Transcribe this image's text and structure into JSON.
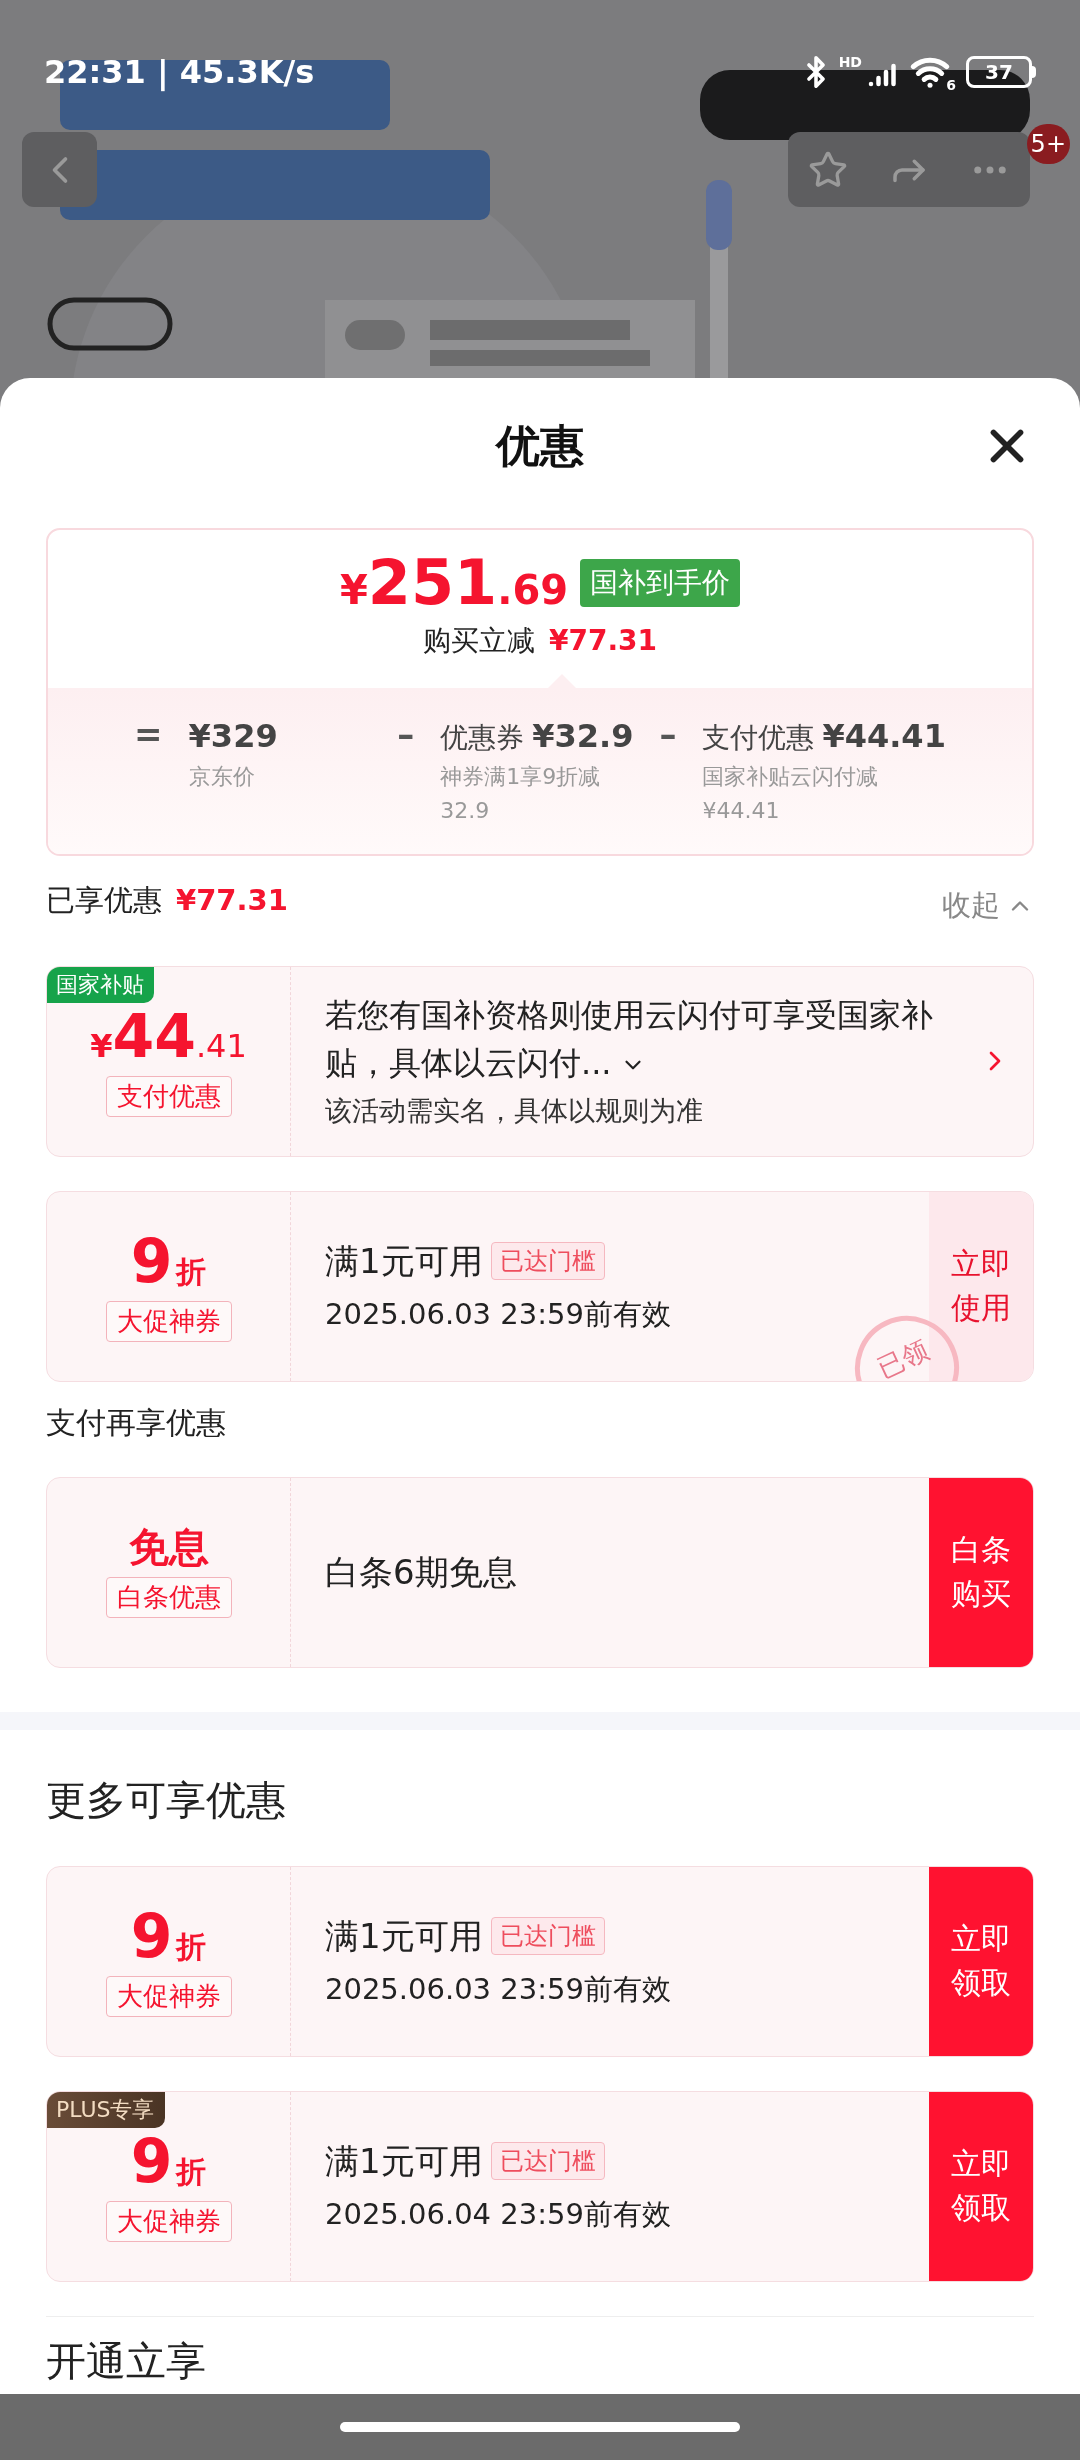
{
  "status_bar": {
    "time": "22:31 | 45.3K/s",
    "network": "HD",
    "wifi_badge": "6",
    "battery": "37"
  },
  "header": {
    "badge": "5+"
  },
  "sheet": {
    "title": "优惠",
    "summary": {
      "currency": "¥",
      "price_main": "251",
      "price_decimal": ".69",
      "price_tag": "国补到手价",
      "saving_label": "购买立减",
      "saving_amount": "¥77.31",
      "breakdown": [
        {
          "operator": "=",
          "amount": "¥329",
          "note": "京东价"
        },
        {
          "operator": "–",
          "label": "优惠券",
          "amount": "¥32.9",
          "note": "神券满1享9折减32.9"
        },
        {
          "operator": "–",
          "label": "支付优惠",
          "amount": "¥44.41",
          "note": "国家补贴云闪付减¥44.41"
        }
      ]
    },
    "applied": {
      "title": "已享优惠",
      "amount": "¥77.31",
      "toggle": "收起",
      "expanded": true
    },
    "applied_cards": [
      {
        "kind": "subsidy",
        "ribbon": "国家补贴",
        "currency": "¥",
        "value": "44",
        "value_decimal": ".41",
        "tag": "支付优惠",
        "title": "若您有国补资格则使用云闪付可享受国家补贴，具体以云闪付...",
        "note": "该活动需实名，具体以规则为准"
      },
      {
        "kind": "coupon",
        "value": "9",
        "unit": "折",
        "tag": "大促神券",
        "condition": "满1元可用",
        "badge": "已达门槛",
        "validity": "2025.06.03 23:59前有效",
        "action": "立即使用",
        "action_filled": false,
        "stamp": "已领"
      }
    ],
    "pay_section": {
      "title": "支付再享优惠"
    },
    "pay_cards": [
      {
        "kind": "installment",
        "value": "免息",
        "tag": "白条优惠",
        "title": "白条6期免息",
        "action": "白条购买",
        "action_filled": true
      }
    ],
    "more_section": {
      "title": "更多可享优惠"
    },
    "more_cards": [
      {
        "kind": "coupon",
        "value": "9",
        "unit": "折",
        "tag": "大促神券",
        "condition": "满1元可用",
        "badge": "已达门槛",
        "validity": "2025.06.03 23:59前有效",
        "action": "立即领取",
        "action_filled": true
      },
      {
        "kind": "coupon",
        "ribbon": "PLUS专享",
        "value": "9",
        "unit": "折",
        "tag": "大促神券",
        "condition": "满1元可用",
        "badge": "已达门槛",
        "validity": "2025.06.04 23:59前有效",
        "action": "立即领取",
        "action_filled": true
      }
    ],
    "next_section": {
      "title": "开通立享"
    }
  }
}
